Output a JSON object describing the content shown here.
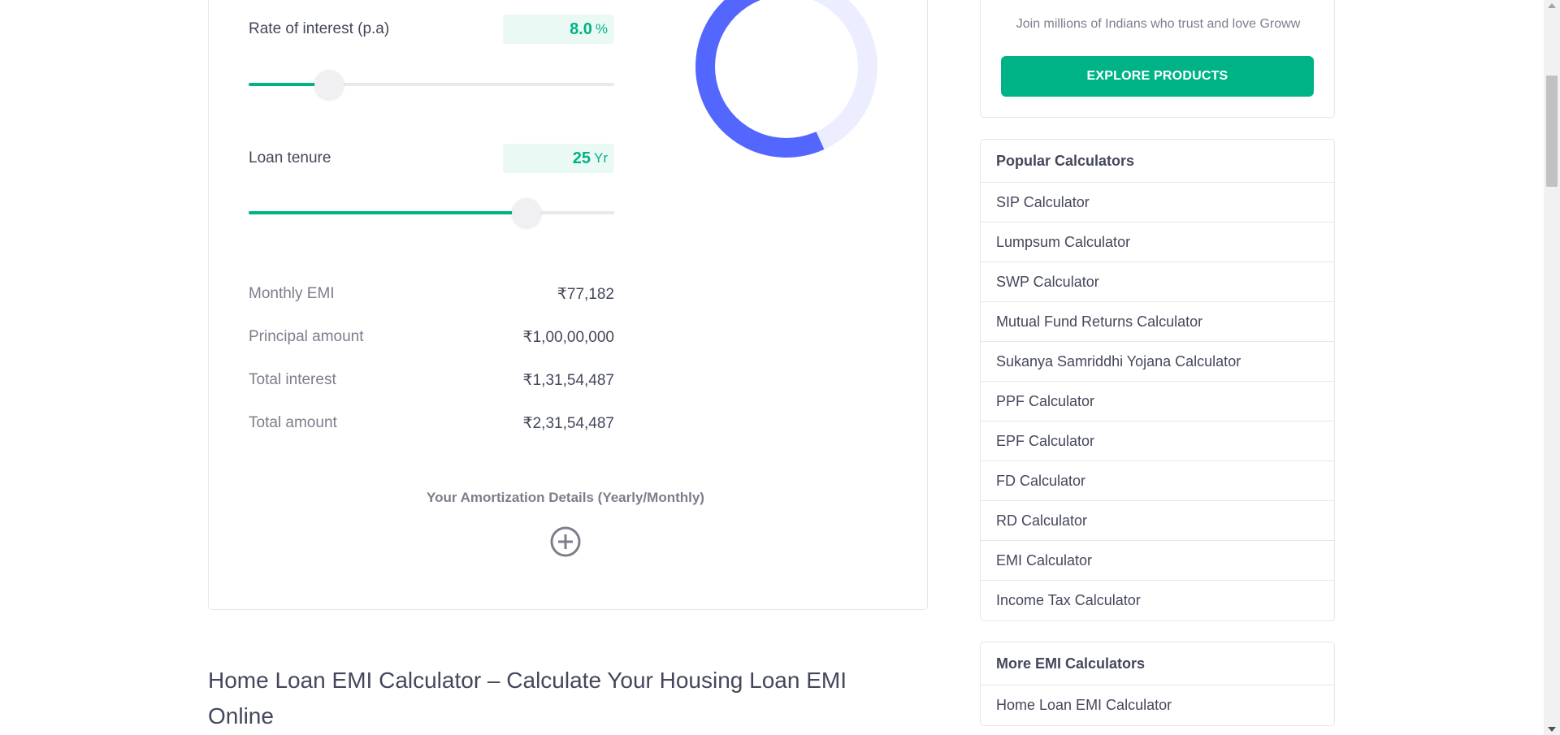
{
  "calculator": {
    "rate": {
      "label": "Rate of interest (p.a)",
      "value": "8.0",
      "unit": "%",
      "slider_fraction": 0.22
    },
    "tenure": {
      "label": "Loan tenure",
      "value": "25",
      "unit": "Yr",
      "slider_fraction": 0.76
    },
    "results": [
      {
        "label": "Monthly EMI",
        "value": "₹77,182"
      },
      {
        "label": "Principal amount",
        "value": "₹1,00,00,000"
      },
      {
        "label": "Total interest",
        "value": "₹1,31,54,487"
      },
      {
        "label": "Total amount",
        "value": "₹2,31,54,487"
      }
    ],
    "amortization_label": "Your Amortization Details (Yearly/Monthly)",
    "donut": {
      "principal_share": 0.432,
      "principal_color": "#eceeff",
      "interest_color": "#5367ff"
    }
  },
  "article": {
    "title": "Home Loan EMI Calculator – Calculate Your Housing Loan EMI Online"
  },
  "promo": {
    "text": "Join millions of Indians who trust and love Groww",
    "button_label": "EXPLORE PRODUCTS"
  },
  "popular": {
    "title": "Popular Calculators",
    "items": [
      "SIP Calculator",
      "Lumpsum Calculator",
      "SWP Calculator",
      "Mutual Fund Returns Calculator",
      "Sukanya Samriddhi Yojana Calculator",
      "PPF Calculator",
      "EPF Calculator",
      "FD Calculator",
      "RD Calculator",
      "EMI Calculator",
      "Income Tax Calculator"
    ]
  },
  "more_emi": {
    "title": "More EMI Calculators",
    "items": [
      "Home Loan EMI Calculator"
    ]
  },
  "colors": {
    "accent": "#00b386",
    "accent_light": "#ebf9f5",
    "text": "#44475b",
    "muted": "#7c7e8c"
  }
}
